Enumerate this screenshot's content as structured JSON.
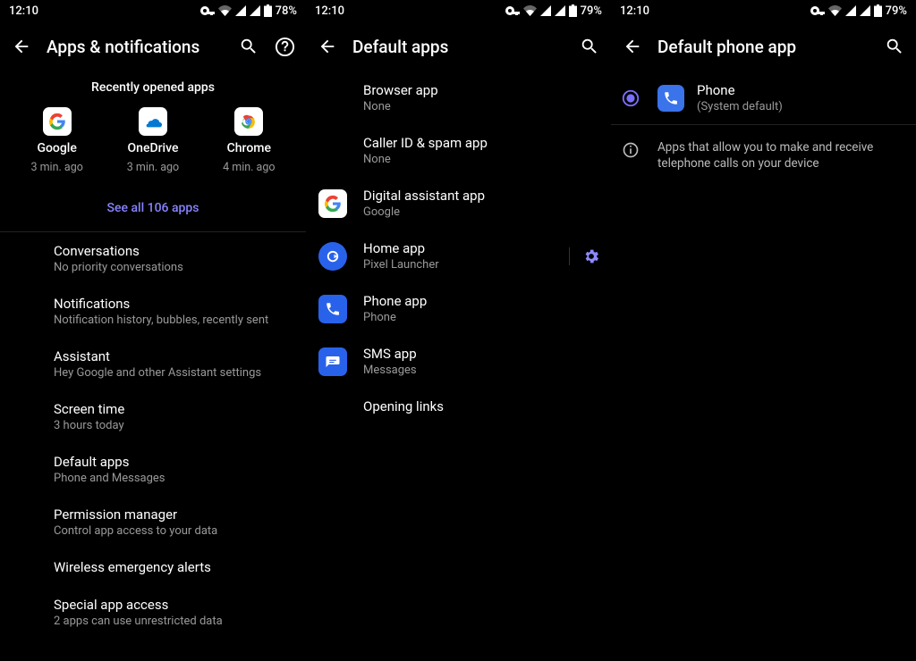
{
  "screen1": {
    "status": {
      "time": "12:10",
      "battery": "78%"
    },
    "title": "Apps & notifications",
    "recent_label": "Recently opened apps",
    "apps": [
      {
        "name": "Google",
        "time": "3 min. ago"
      },
      {
        "name": "OneDrive",
        "time": "3 min. ago"
      },
      {
        "name": "Chrome",
        "time": "4 min. ago"
      }
    ],
    "see_all": "See all 106 apps",
    "items": [
      {
        "title": "Conversations",
        "sub": "No priority conversations"
      },
      {
        "title": "Notifications",
        "sub": "Notification history, bubbles, recently sent"
      },
      {
        "title": "Assistant",
        "sub": "Hey Google and other Assistant settings"
      },
      {
        "title": "Screen time",
        "sub": "3 hours today"
      },
      {
        "title": "Default apps",
        "sub": "Phone and Messages"
      },
      {
        "title": "Permission manager",
        "sub": "Control app access to your data"
      },
      {
        "title": "Wireless emergency alerts",
        "sub": ""
      },
      {
        "title": "Special app access",
        "sub": "2 apps can use unrestricted data"
      }
    ]
  },
  "screen2": {
    "status": {
      "time": "12:10",
      "battery": "79%"
    },
    "title": "Default apps",
    "items": [
      {
        "title": "Browser app",
        "sub": "None",
        "icon": ""
      },
      {
        "title": "Caller ID & spam app",
        "sub": "None",
        "icon": ""
      },
      {
        "title": "Digital assistant app",
        "sub": "Google",
        "icon": "google"
      },
      {
        "title": "Home app",
        "sub": "Pixel Launcher",
        "icon": "pixel",
        "gear": true
      },
      {
        "title": "Phone app",
        "sub": "Phone",
        "icon": "phone"
      },
      {
        "title": "SMS app",
        "sub": "Messages",
        "icon": "messages"
      },
      {
        "title": "Opening links",
        "sub": "",
        "icon": ""
      }
    ]
  },
  "screen3": {
    "status": {
      "time": "12:10",
      "battery": "79%"
    },
    "title": "Default app",
    "title_full": "Default phone app",
    "option": {
      "name": "Phone",
      "sub": "(System default)"
    },
    "info": "Apps that allow you to make and receive telephone calls on your device"
  }
}
